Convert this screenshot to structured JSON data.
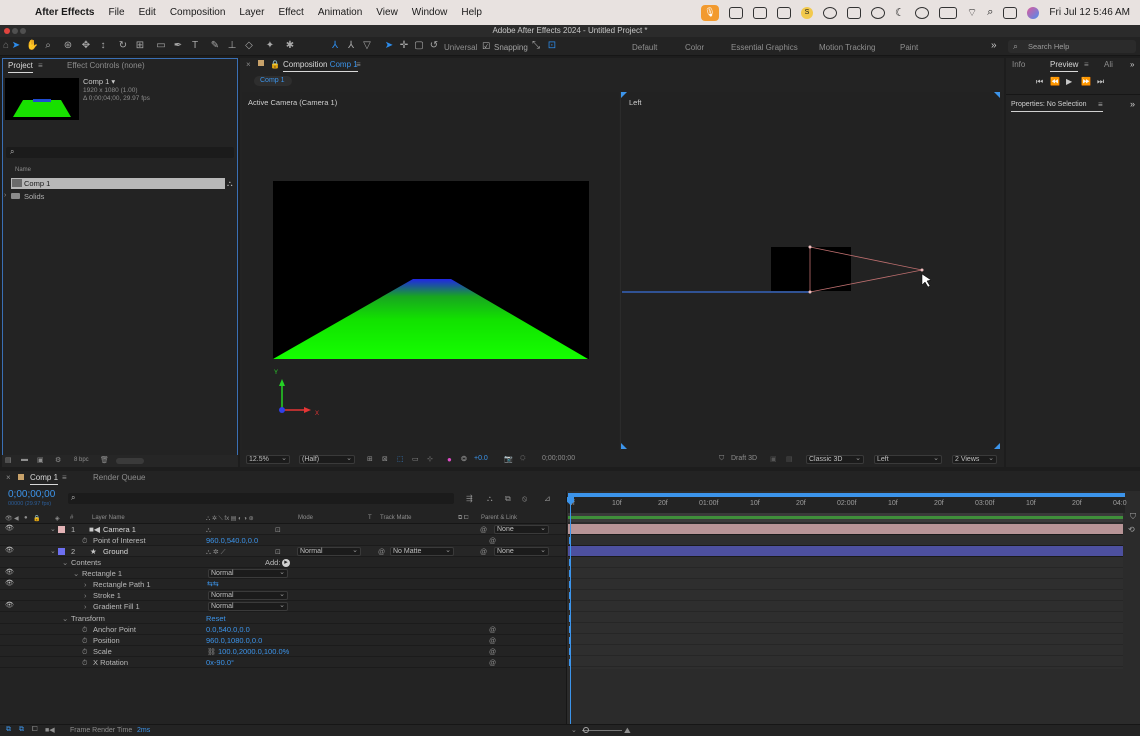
{
  "menubar": {
    "app_name": "After Effects",
    "items": [
      "File",
      "Edit",
      "Composition",
      "Layer",
      "Effect",
      "Animation",
      "View",
      "Window",
      "Help"
    ],
    "clock": "Fri Jul 12  5:46 AM",
    "status_s": "S"
  },
  "window": {
    "title": "Adobe After Effects 2024 - Untitled Project *"
  },
  "toolbar": {
    "universal": "Universal",
    "snapping": "Snapping",
    "workspaces": [
      "Default",
      "Color",
      "Essential Graphics",
      "Motion Tracking",
      "Paint"
    ],
    "more": "»",
    "search_placeholder": "Search Help"
  },
  "project_panel": {
    "tab_project": "Project",
    "tab_effect_controls": "Effect Controls (none)",
    "comp_name": "Comp 1 ▾",
    "comp_size": "1920 x 1080 (1.00)",
    "comp_duration": "Δ 0;00;04;00, 29.97 fps",
    "col_name": "Name",
    "items": [
      {
        "name": "Comp 1",
        "type": "comp"
      },
      {
        "name": "Solids",
        "type": "folder"
      }
    ],
    "bpc": "8 bpc"
  },
  "composition_panel": {
    "tab_label": "Composition",
    "tab_comp": "Comp 1",
    "breadcrumb": "Comp 1",
    "left_view_label": "Active Camera (Camera 1)",
    "right_view_label": "Left",
    "zoom": "12.5%",
    "resolution": "(Half)",
    "exposure": "+0.0",
    "timecode": "0;00;00;00",
    "renderer_mode": "Draft 3D",
    "renderer": "Classic 3D",
    "view": "Left",
    "views": "2 Views",
    "axis_x": "X",
    "axis_y": "Y"
  },
  "info_panel": {
    "tab_info": "Info",
    "tab_preview": "Preview",
    "tab_align": "Ali",
    "properties": "Properties: No Selection"
  },
  "timeline": {
    "tab_comp": "Comp 1",
    "tab_render_queue": "Render Queue",
    "timecode": "0;00;00;00",
    "frame_info": "00000 (29.97 fps)",
    "col_hash": "#",
    "col_layer_name": "Layer Name",
    "col_mode": "Mode",
    "col_t": "T",
    "col_track_matte": "Track Matte",
    "col_parent": "Parent & Link",
    "ruler": [
      "0f",
      "10f",
      "20f",
      "01:00f",
      "10f",
      "20f",
      "02:00f",
      "10f",
      "20f",
      "03:00f",
      "10f",
      "20f",
      "04:0"
    ],
    "layers": [
      {
        "num": "1",
        "name": "Camera 1",
        "color": "#e3b3b6",
        "parent": "None"
      },
      {
        "num": "2",
        "name": "Ground",
        "color": "#6d6ff0",
        "mode": "Normal",
        "matte": "No Matte",
        "parent": "None"
      }
    ],
    "props": {
      "point_of_interest": "Point of Interest",
      "poi_value": "960.0,540.0,0.0",
      "contents": "Contents",
      "add": "Add:",
      "rectangle1": "Rectangle 1",
      "rectangle_path1": "Rectangle Path 1",
      "stroke1": "Stroke 1",
      "gradient_fill1": "Gradient Fill 1",
      "normal": "Normal",
      "transform": "Transform",
      "reset": "Reset",
      "anchor_point": "Anchor Point",
      "anchor_value": "0.0,540.0,0.0",
      "position": "Position",
      "position_value": "960.0,1080.0,0.0",
      "scale": "Scale",
      "scale_value": "100.0,2000.0,100.0%",
      "x_rotation": "X Rotation",
      "x_rotation_value": "0x-90.0°"
    },
    "status_label": "Frame Render Time",
    "status_value": "2ms"
  },
  "colors": {
    "accent": "#3c94ea",
    "camera_bar": "#b79496",
    "ground_bar": "#4d509f",
    "green_work": "#3f8f3a"
  }
}
